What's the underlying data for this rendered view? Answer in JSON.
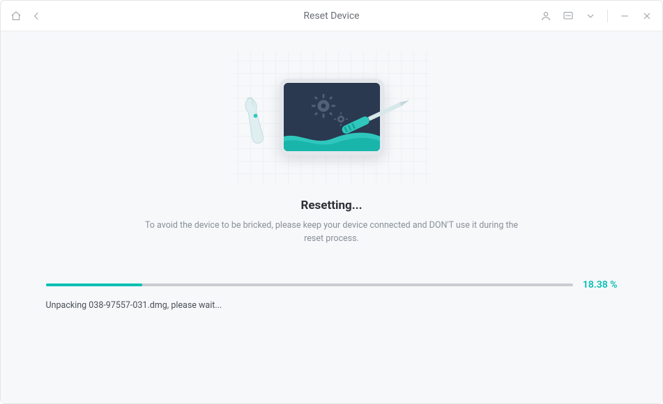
{
  "titlebar": {
    "title": "Reset Device"
  },
  "main": {
    "heading": "Resetting...",
    "subtext": "To avoid the device to be bricked, please keep your device connected and DON'T use it during the reset process."
  },
  "progress": {
    "percent_value": 18.38,
    "percent_label": "18.38 %",
    "status": "Unpacking 038-97557-031.dmg, please wait..."
  },
  "colors": {
    "accent": "#07bfb3"
  }
}
